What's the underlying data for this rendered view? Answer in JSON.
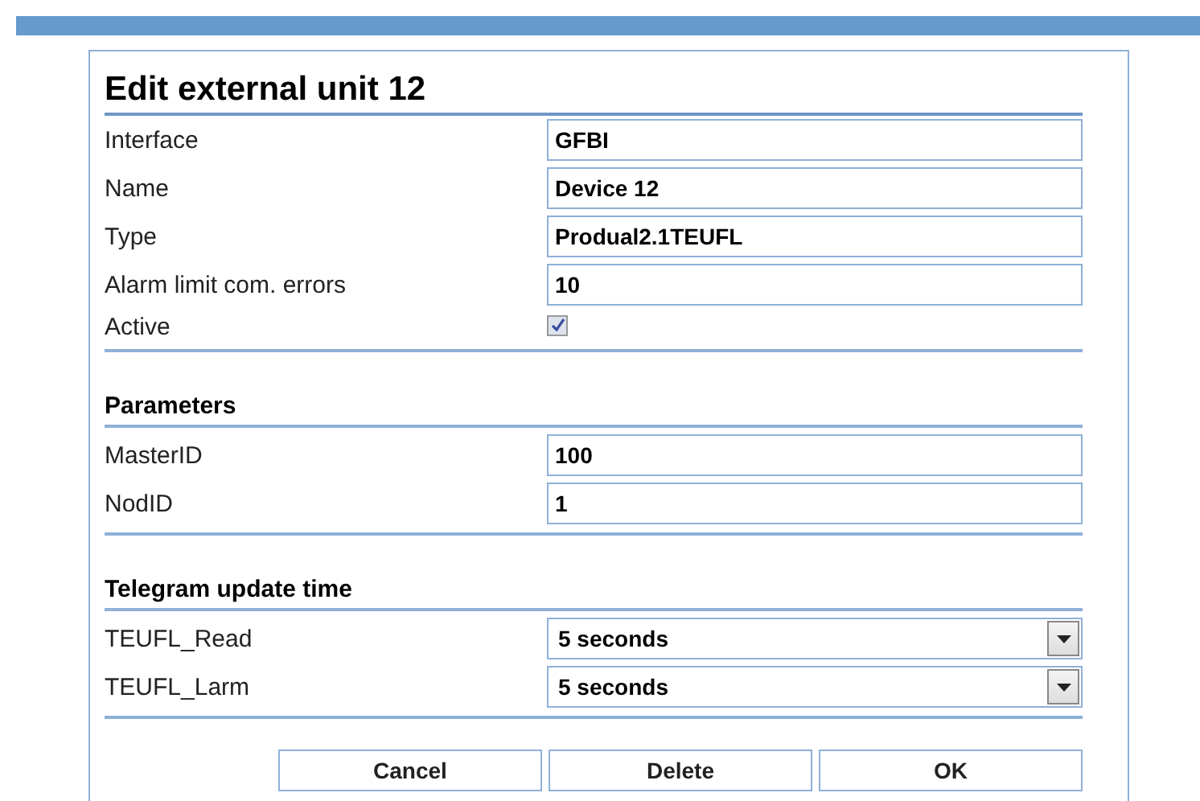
{
  "dialog": {
    "title": "Edit external unit 12",
    "sections": [
      {
        "rows": [
          {
            "label": "Interface",
            "kind": "text",
            "value": "GFBI"
          },
          {
            "label": "Name",
            "kind": "text",
            "value": "Device 12"
          },
          {
            "label": "Type",
            "kind": "text",
            "value": "Produal2.1TEUFL"
          },
          {
            "label": "Alarm limit com. errors",
            "kind": "text",
            "value": "10"
          },
          {
            "label": "Active",
            "kind": "checkbox",
            "checked": true
          }
        ]
      },
      {
        "heading": "Parameters",
        "rows": [
          {
            "label": "MasterID",
            "kind": "text",
            "value": "100"
          },
          {
            "label": "NodID",
            "kind": "text",
            "value": "1"
          }
        ]
      },
      {
        "heading": "Telegram update time",
        "rows": [
          {
            "label": "TEUFL_Read",
            "kind": "select",
            "value": "5 seconds"
          },
          {
            "label": "TEUFL_Larm",
            "kind": "select",
            "value": "5 seconds"
          }
        ]
      }
    ],
    "buttons": [
      "Cancel",
      "Delete",
      "OK"
    ]
  }
}
